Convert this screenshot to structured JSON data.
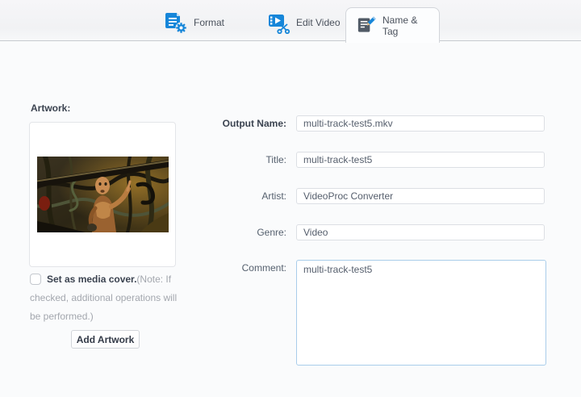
{
  "tabs": [
    {
      "label": "Format",
      "active": false
    },
    {
      "label": "Edit Video",
      "active": false
    },
    {
      "label": "Name & Tag",
      "active": true
    }
  ],
  "artwork": {
    "section_label": "Artwork:",
    "image_alt": "video-thumbnail-artwork",
    "checkbox_checked": false,
    "checkbox_label": "Set as media cover.",
    "checkbox_note": "(Note: If checked, additional operations will be performed.)",
    "add_button_label": "Add Artwork"
  },
  "fields": {
    "output_name": {
      "label": "Output Name:",
      "value": "multi-track-test5.mkv"
    },
    "title": {
      "label": "Title:",
      "value": "multi-track-test5"
    },
    "artist": {
      "label": "Artist:",
      "value": "VideoProc Converter"
    },
    "genre": {
      "label": "Genre:",
      "value": "Video"
    },
    "comment": {
      "label": "Comment:",
      "value": "multi-track-test5"
    }
  },
  "colors": {
    "accent_blue": "#1686d9",
    "tab_icon_dark": "#515b67",
    "comment_focus_border": "#a9cdea",
    "tabbar_bg": "#f1f2f4",
    "content_bg": "#fafbfc"
  }
}
